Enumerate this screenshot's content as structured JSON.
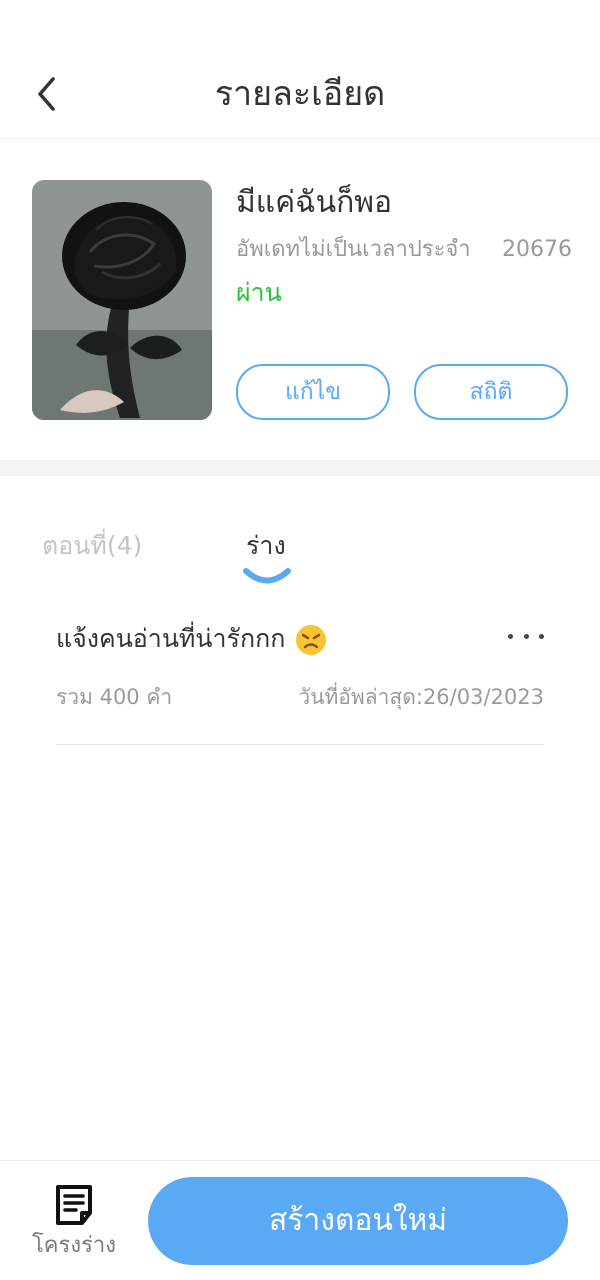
{
  "header": {
    "title": "รายละเอียด",
    "back_icon": "chevron-left-icon"
  },
  "book": {
    "title": "มีแค่ฉันก็พอ",
    "update_schedule": "อัพเดทไม่เป็นเวลาประจำ",
    "count": "20676",
    "status": "ผ่าน",
    "status_color": "#2fbf3a",
    "edit_label": "แก้ไข",
    "stats_label": "สถิติ",
    "cover_icon": "black-rose-cover-image"
  },
  "tabs": [
    {
      "label": "ตอนที่(4)",
      "active": false
    },
    {
      "label": "ร่าง",
      "active": true
    }
  ],
  "drafts": [
    {
      "title": "แจ้งคนอ่านที่น่ารักกก",
      "emoji": "angry-face-emoji",
      "word_count": "รวม 400 คำ",
      "last_updated": "วันที่อัพล่าสุด:26/03/2023"
    }
  ],
  "bottom": {
    "outline_label": "โครงร่าง",
    "outline_icon": "document-lines-icon",
    "create_label": "สร้างตอนใหม่"
  },
  "colors": {
    "accent": "#5aa9f5",
    "background": "#ffffff"
  }
}
